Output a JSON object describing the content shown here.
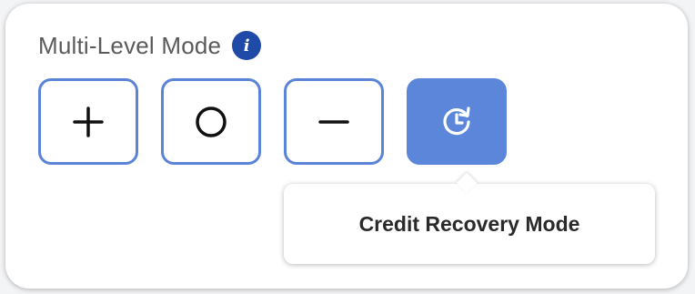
{
  "panel": {
    "title": "Multi-Level Mode",
    "info_icon": "info-icon",
    "info_glyph": "i"
  },
  "modes": [
    {
      "id": "plus",
      "icon": "plus-icon",
      "active": false
    },
    {
      "id": "circle",
      "icon": "circle-icon",
      "active": false
    },
    {
      "id": "minus",
      "icon": "minus-icon",
      "active": false
    },
    {
      "id": "credit-recovery",
      "icon": "clock-refresh-icon",
      "active": true
    }
  ],
  "tooltip": {
    "text": "Credit Recovery Mode"
  },
  "colors": {
    "accent": "#5b86da",
    "info_badge": "#1f4aa8",
    "title_text": "#5a5a5a"
  }
}
